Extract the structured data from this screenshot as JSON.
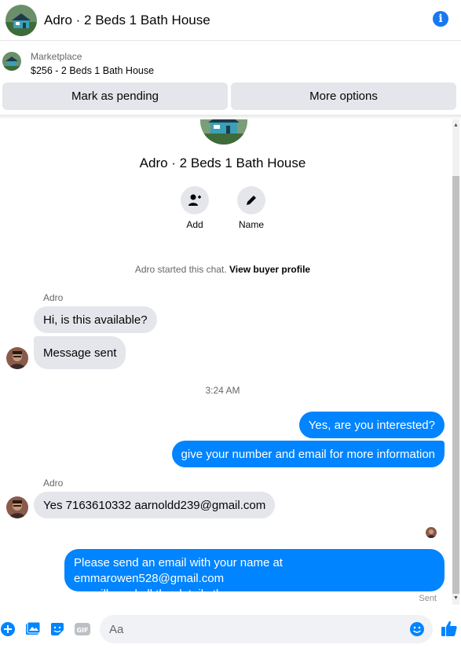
{
  "header": {
    "title": "Adro · 2 Beds 1 Bath House"
  },
  "marketplace": {
    "label": "Marketplace",
    "listing": "$256 - 2 Beds 1 Bath House"
  },
  "actions": {
    "mark_pending": "Mark as pending",
    "more_options": "More options"
  },
  "conversation": {
    "title": "Adro · 2 Beds 1 Bath House",
    "add_label": "Add",
    "name_label": "Name",
    "started_text": "Adro started this chat.",
    "buyer_profile_link": "View buyer profile"
  },
  "messages": {
    "sender_1": "Adro",
    "in_1": "Hi, is this available?",
    "in_2": "Message sent",
    "time": "3:24 AM",
    "out_1": "Yes, are you interested?",
    "out_2": "give your number and email for more information",
    "sender_2": "Adro",
    "in_3": "Yes 7163610332 aarnoldd239@gmail.com",
    "out_3_line1": "Please send an email with your name at emmarowen528@gmail.com",
    "out_3_line2": "we will send all the details there...",
    "status": "Sent"
  },
  "composer": {
    "placeholder": "Aa"
  },
  "colors": {
    "accent": "#0084ff",
    "brand_blue": "#1877f2",
    "bubble_in": "#e4e6eb"
  },
  "icons": [
    "info-icon",
    "add-person-icon",
    "pencil-icon",
    "plus-icon",
    "image-icon",
    "sticker-icon",
    "gif-icon",
    "emoji-icon",
    "thumbs-up-icon"
  ]
}
